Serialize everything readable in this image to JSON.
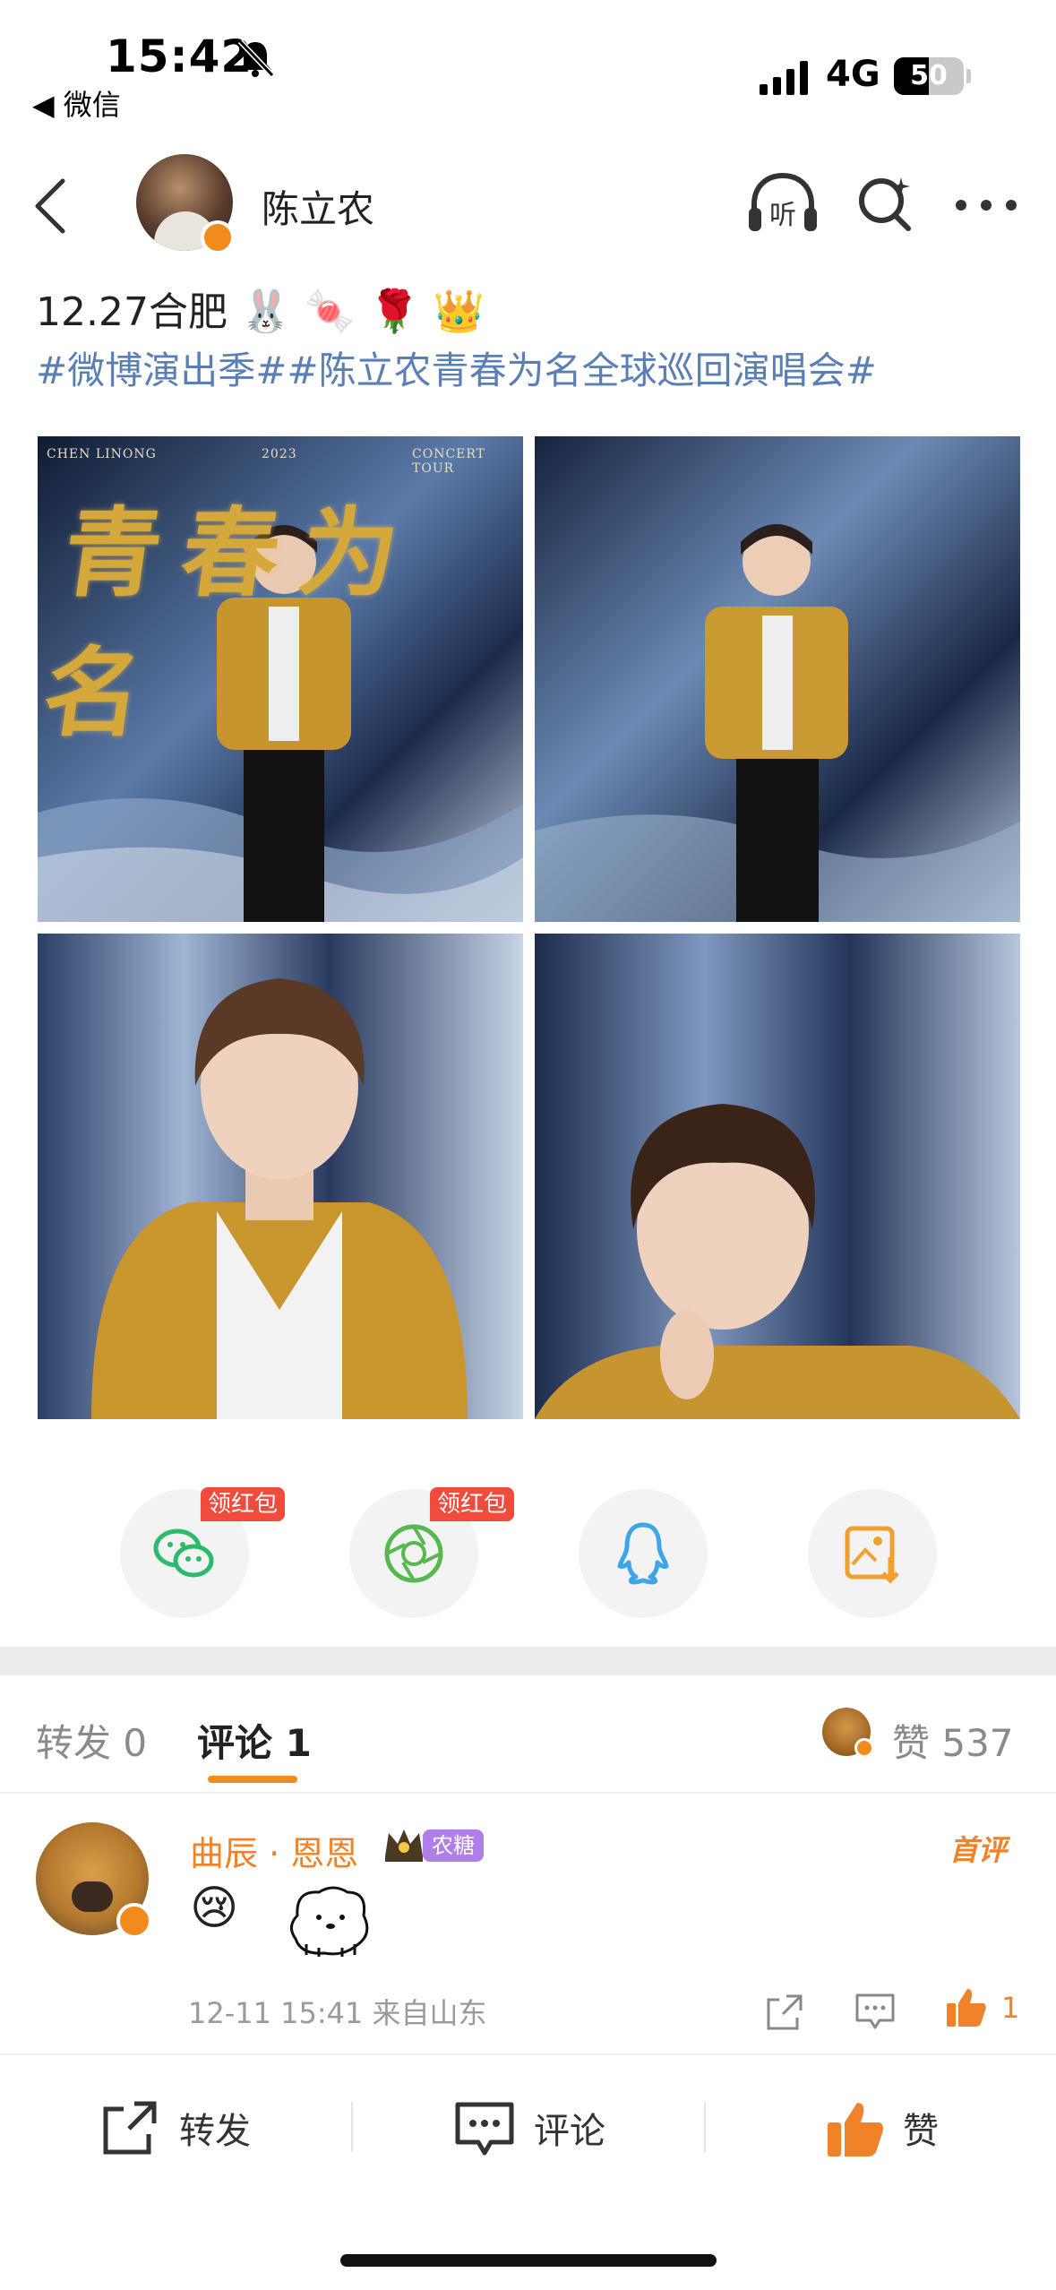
{
  "status_bar": {
    "time": "15:42",
    "back_app": "◀ 微信",
    "network": "4G",
    "battery": "50"
  },
  "nav": {
    "author_name": "陈立农",
    "listen_label": "听"
  },
  "post": {
    "line1_text": "12.27合肥",
    "line1_emojis": "🐰 🍬 🌹 👑",
    "hashtags": "#微博演出季##陈立农青春为名全球巡回演唱会#",
    "photo_caption_left": "CHEN LINONG",
    "photo_caption_mid": "2023",
    "photo_caption_right": "CONCERT TOUR",
    "photo_title": "青春为名"
  },
  "share": {
    "red_tag": "领红包",
    "items": [
      "wechat-share",
      "moments-share",
      "qq-share",
      "save-image"
    ],
    "colors": {
      "wechat": "#2dba6c",
      "moments": "#56b84e",
      "qq": "#3ea5e8",
      "save": "#f0a030"
    }
  },
  "tabs": {
    "repost": "转发 0",
    "comment": "评论 1",
    "likes": "赞 537"
  },
  "comment": {
    "user": "曲辰 · 恩恩",
    "fan_badge": "农糖",
    "first_tag": "首评",
    "emoji": "😢",
    "meta": "12-11 15:41  来自山东",
    "like_count": "1"
  },
  "toolbar": {
    "repost": "转发",
    "comment": "评论",
    "like": "赞"
  },
  "colors": {
    "accent": "#f28b1e",
    "link": "#5a7fb5",
    "like": "#f0822a"
  }
}
